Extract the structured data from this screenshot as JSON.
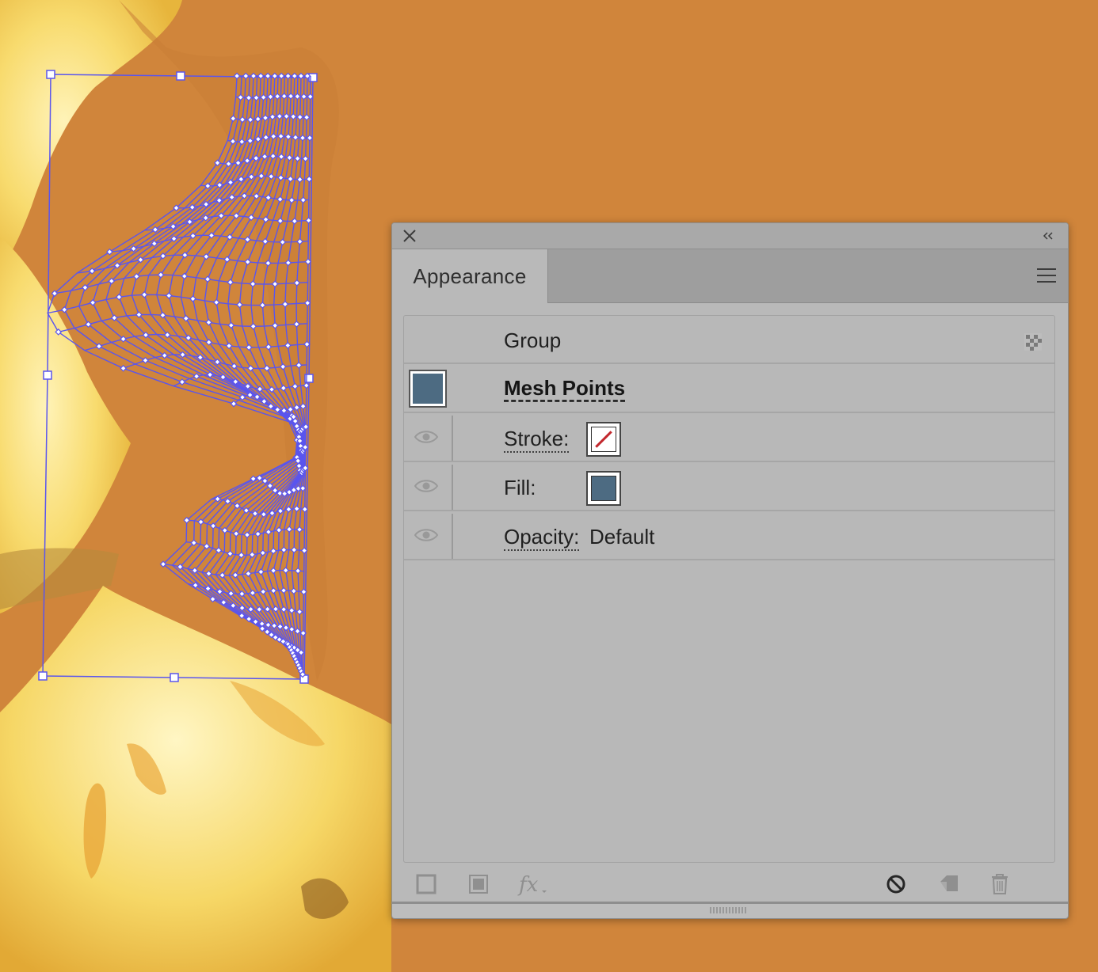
{
  "panel": {
    "tab_label": "Appearance",
    "rows": {
      "group_label": "Group",
      "mesh_label": "Mesh Points",
      "stroke_label": "Stroke:",
      "fill_label": "Fill:",
      "opacity_label": "Opacity:",
      "opacity_value": "Default"
    },
    "swatch_fill_color": "#4d6b82",
    "stroke_none_color": "#c2272d"
  },
  "canvas": {
    "background_color": "#d0853b",
    "mesh_color": "#5a55ee"
  }
}
